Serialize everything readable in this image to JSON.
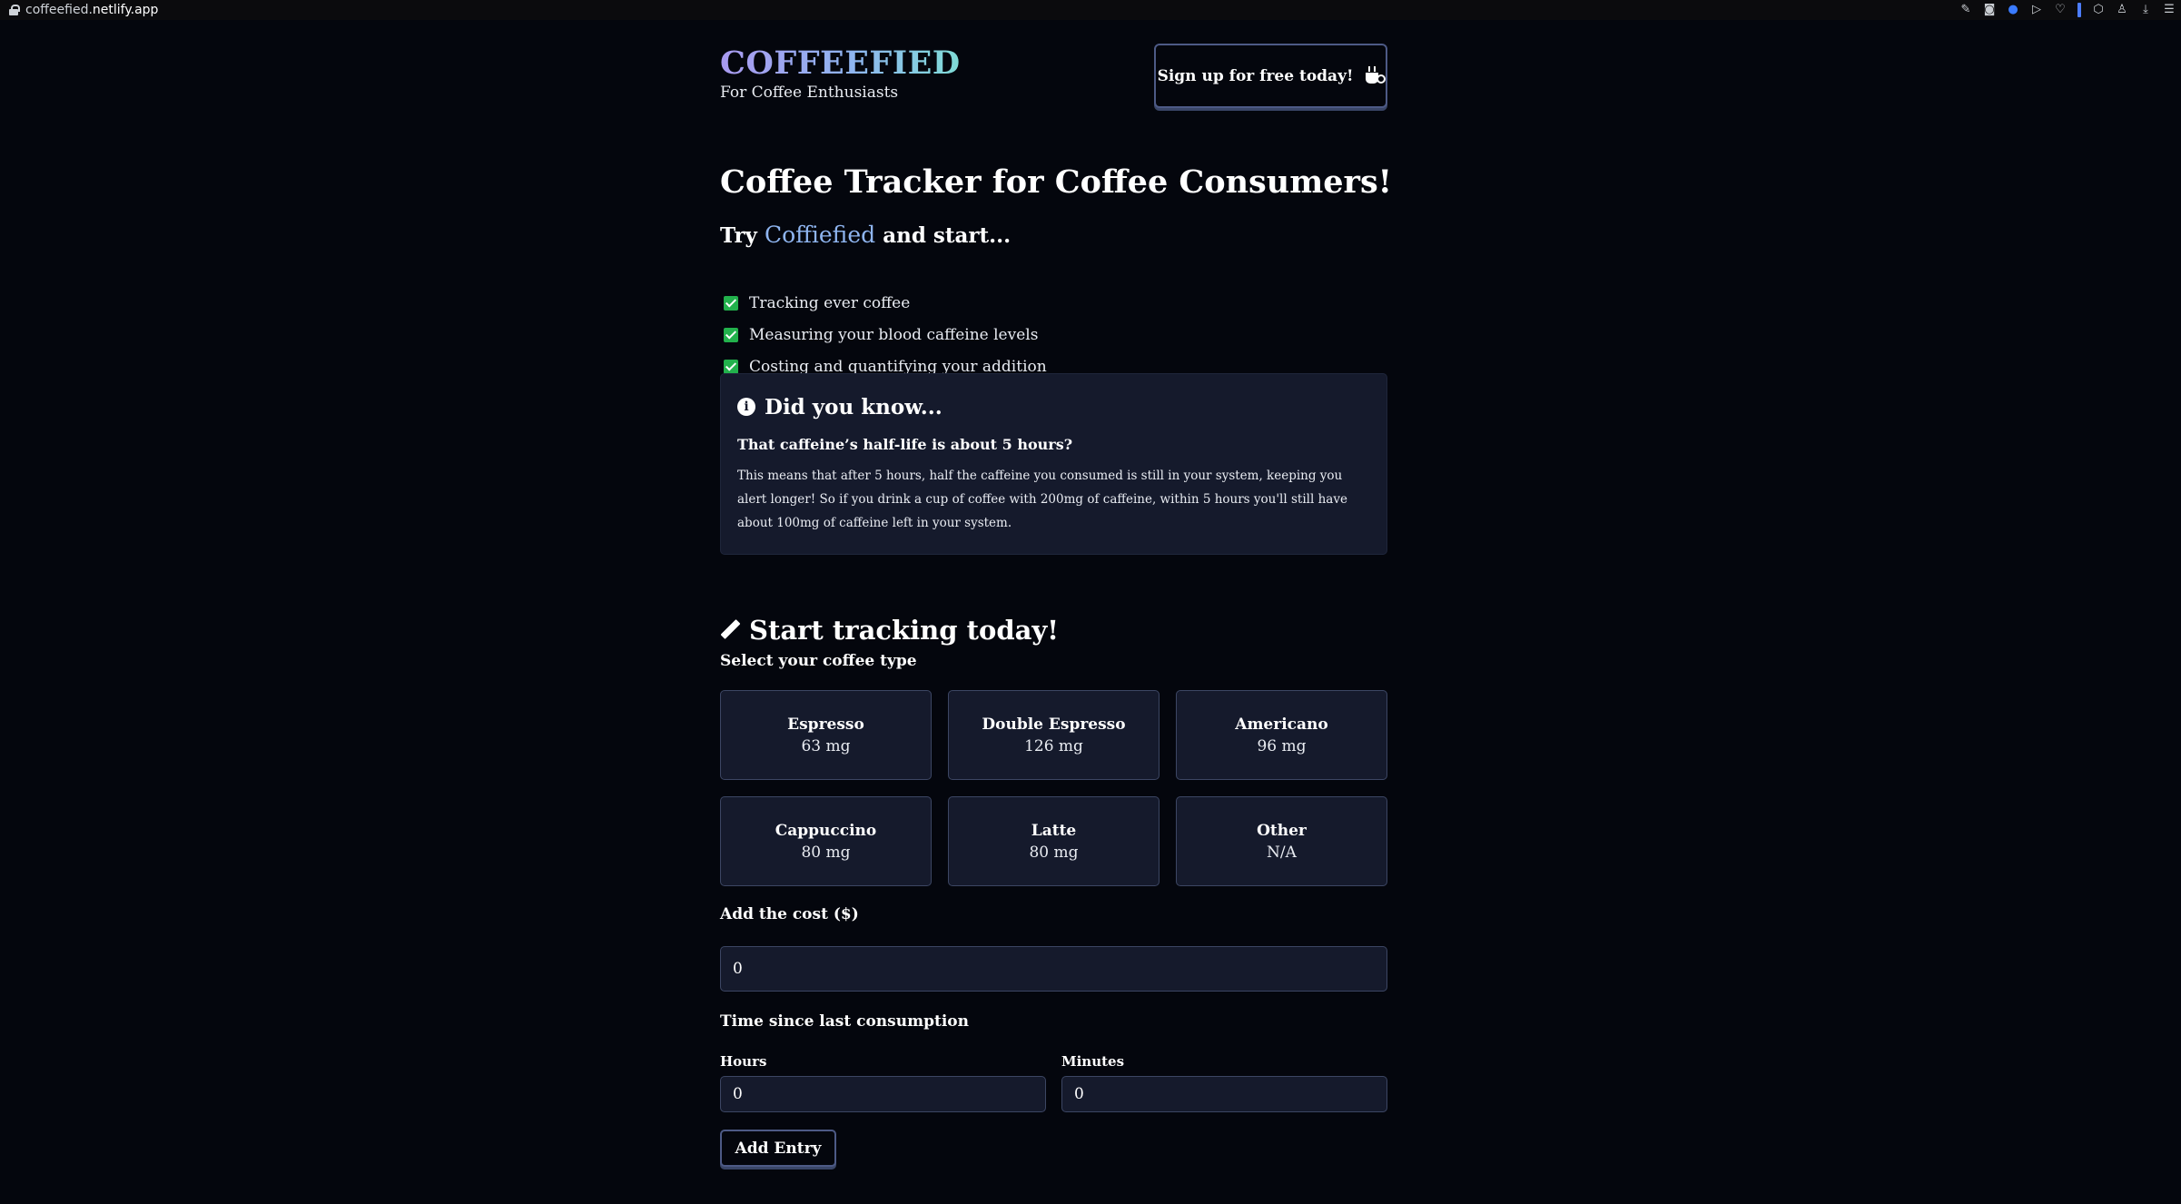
{
  "browser": {
    "url_host_prefix": "coffeefied.",
    "url_host_domain": "netlify.app"
  },
  "header": {
    "logo": "COFFEEFIED",
    "tagline": "For Coffee Enthusiasts",
    "signup_label": "Sign up for free today!"
  },
  "hero": {
    "title": "Coffee Tracker for Coffee Consumers!",
    "try_prefix": "Try",
    "try_brand": "Coffiefied",
    "try_suffix": "and start...",
    "benefits": [
      "Tracking ever coffee",
      "Measuring your blood caffeine levels",
      "Costing and quantifying your addition"
    ]
  },
  "info": {
    "title": "Did you know...",
    "question": "That caffeine’s half-life is about 5 hours?",
    "body": "This means that after 5 hours, half the caffeine you consumed is still in your system, keeping you alert longer! So if you drink a cup of coffee with 200mg of caffeine, within 5 hours you'll still have about 100mg of caffeine left in your system."
  },
  "tracker": {
    "title": "Start tracking today!",
    "select_label": "Select your coffee type",
    "types": [
      {
        "name": "Espresso",
        "mg": "63 mg"
      },
      {
        "name": "Double Espresso",
        "mg": "126 mg"
      },
      {
        "name": "Americano",
        "mg": "96 mg"
      },
      {
        "name": "Cappuccino",
        "mg": "80 mg"
      },
      {
        "name": "Latte",
        "mg": "80 mg"
      },
      {
        "name": "Other",
        "mg": "N/A"
      }
    ],
    "cost_label": "Add the cost ($)",
    "cost_value": "0",
    "time_label": "Time since last consumption",
    "hours_label": "Hours",
    "hours_value": "0",
    "minutes_label": "Minutes",
    "minutes_value": "0",
    "add_label": "Add Entry"
  },
  "colors": {
    "background": "#04060d",
    "card": "#151a2c",
    "accent": "#8fb5f0",
    "check": "#22b14c"
  }
}
